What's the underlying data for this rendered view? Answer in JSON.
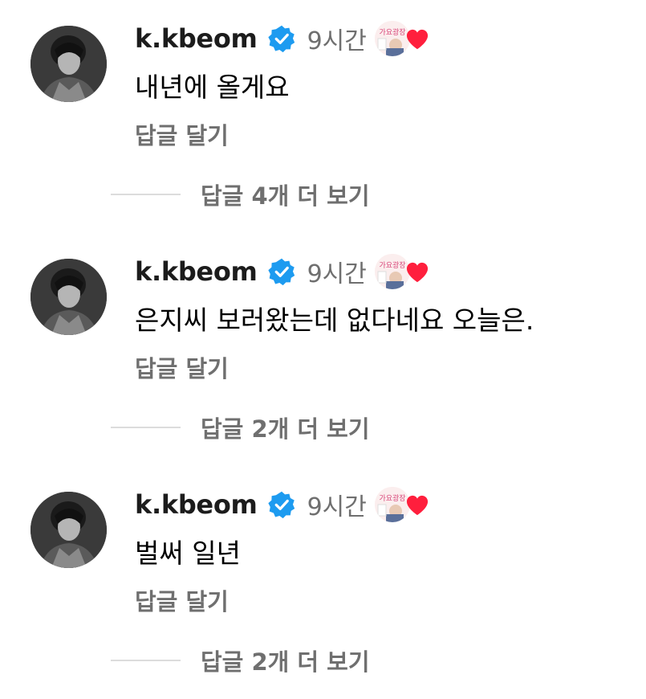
{
  "comments": [
    {
      "username": "k.kbeom",
      "time": "9시간",
      "text": "내년에 올게요",
      "reply_label": "답글 달기",
      "more_replies_label": "답글 4개 더 보기",
      "liked_by_sticker_text": "가요광장"
    },
    {
      "username": "k.kbeom",
      "time": "9시간",
      "text": "은지씨 보러왔는데 없다네요 오늘은.",
      "reply_label": "답글 달기",
      "more_replies_label": "답글 2개 더 보기",
      "liked_by_sticker_text": "가요광장"
    },
    {
      "username": "k.kbeom",
      "time": "9시간",
      "text": "벌써 일년",
      "reply_label": "답글 달기",
      "more_replies_label": "답글 2개 더 보기",
      "liked_by_sticker_text": "가요광장"
    }
  ],
  "colors": {
    "verified_badge": "#1d9bf0",
    "heart": "#ff1f3d",
    "secondary_text": "#6f6f6f",
    "primary_text": "#000000"
  },
  "icons": {
    "verified": "verified-badge-icon",
    "heart": "heart-icon"
  }
}
